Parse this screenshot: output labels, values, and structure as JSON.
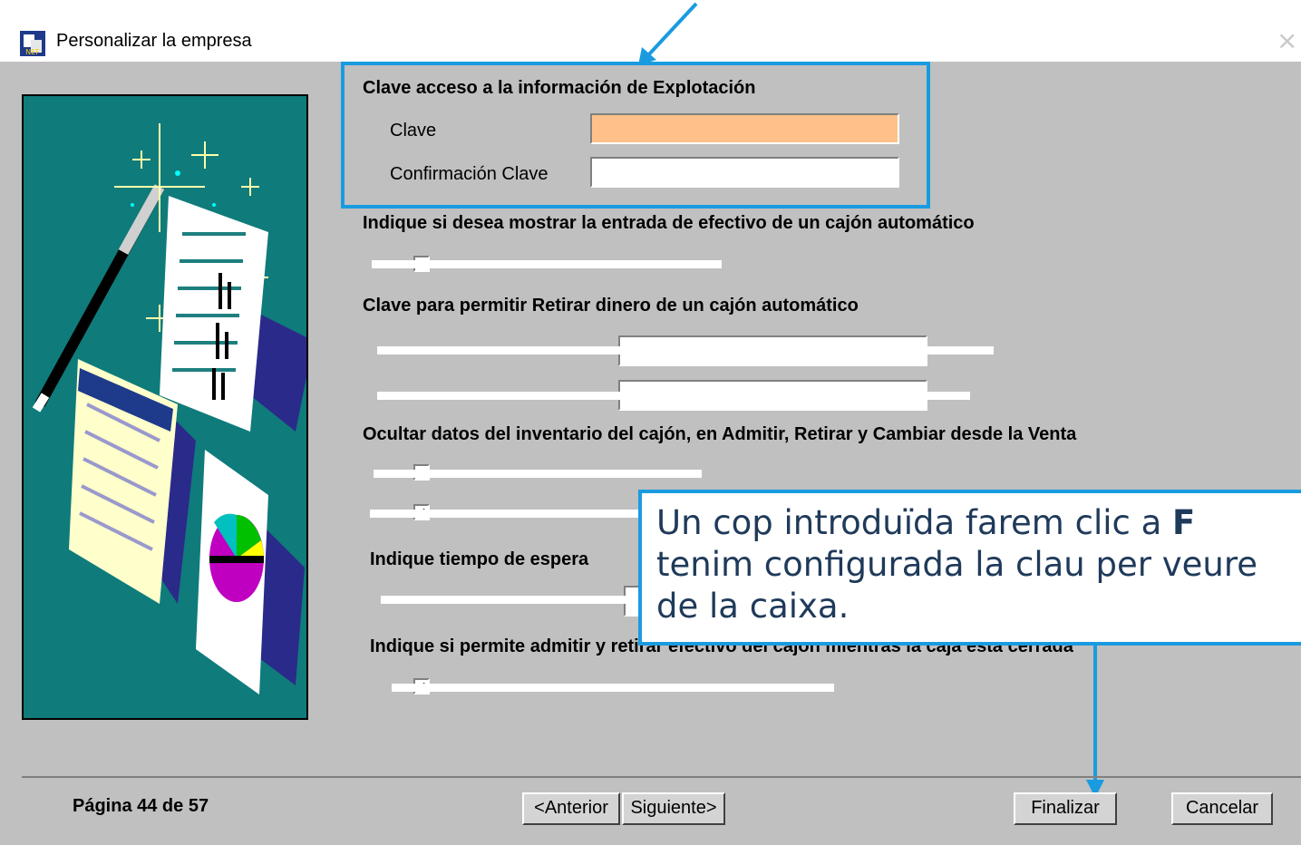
{
  "window": {
    "title": "Personalizar la empresa",
    "close_glyph": "×",
    "app_icon": "wizard-app-icon"
  },
  "section_password": {
    "header": "Clave acceso a la información  de Explotación",
    "clave_label": "Clave",
    "confirm_label": "Confirmación Clave",
    "clave_value": "",
    "confirm_value": "",
    "clave_bg": "#ffc189"
  },
  "section_cash_entry": {
    "header": "Indique si desea mostrar la entrada de efectivo de un cajón automático",
    "checkbox_mark": "✓"
  },
  "section_withdraw": {
    "header": "Clave para permitir Retirar dinero de un cajón automático"
  },
  "section_hide": {
    "header": "Ocultar datos del inventario del cajón, en Admitir, Retirar y Cambiar desde la Venta",
    "checkbox2_mark": "✓"
  },
  "section_wait": {
    "header": "Indique tiempo de espera"
  },
  "section_closed": {
    "header": "Indique si permite admitir y retirar efectivo del cajón mientras la caja está cerrada",
    "checkbox_mark": "✓"
  },
  "footer": {
    "page_label": "Página 44 de 57",
    "prev_button": "<Anterior",
    "next_button": "Siguiente>",
    "finish_button": "Finalizar",
    "cancel_button": "Cancelar"
  },
  "annotation": {
    "lines": [
      "Un cop introduïda farem clic a F",
      "tenim configurada la clau per veure",
      "de la caixa."
    ],
    "accent": "#1a9be0"
  },
  "colors": {
    "dialog_bg": "#c0c0c0",
    "illustration_bg": "#0f7b7b"
  }
}
